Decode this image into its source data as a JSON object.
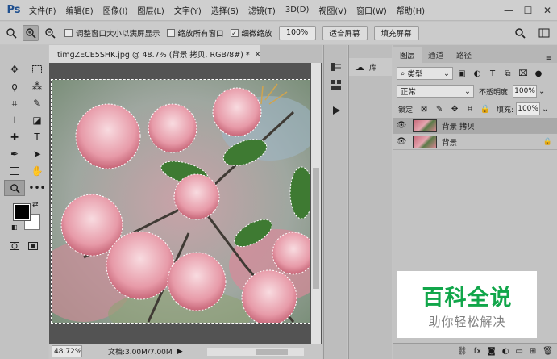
{
  "app": {
    "logo": "Ps"
  },
  "menu": [
    "文件(F)",
    "编辑(E)",
    "图像(I)",
    "图层(L)",
    "文字(Y)",
    "选择(S)",
    "滤镜(T)",
    "3D(D)",
    "视图(V)",
    "窗口(W)",
    "帮助(H)"
  ],
  "window_controls": {
    "minimize": "—",
    "maximize": "☐",
    "close": "✕"
  },
  "options": {
    "resize_windows": "调整窗口大小以满屏显示",
    "zoom_all": "缩放所有窗口",
    "scrubby_zoom": "细微缩放",
    "scrubby_checked": "✓",
    "percent": "100%",
    "fit_screen": "适合屏幕",
    "fill_screen": "填充屏幕"
  },
  "document": {
    "tab_title": "timgZECE5SHK.jpg @ 48.7% (背景 拷贝, RGB/8#) *",
    "close": "×",
    "zoom": "48.72%",
    "doc_info": "文档:3.00M/7.00M",
    "arrow": "▶"
  },
  "library": {
    "label": "库"
  },
  "layers_panel": {
    "tabs": [
      "图层",
      "通道",
      "路径"
    ],
    "filter_kind": "类型",
    "blend_mode": "正常",
    "opacity_label": "不透明度:",
    "opacity": "100%",
    "lock_label": "锁定:",
    "fill_label": "填充:",
    "fill": "100%",
    "layers": [
      {
        "name": "背景 拷贝",
        "selected": true
      },
      {
        "name": "背景",
        "selected": false
      }
    ]
  },
  "watermark": {
    "title": "百科全说",
    "subtitle": "助你轻松解决"
  }
}
